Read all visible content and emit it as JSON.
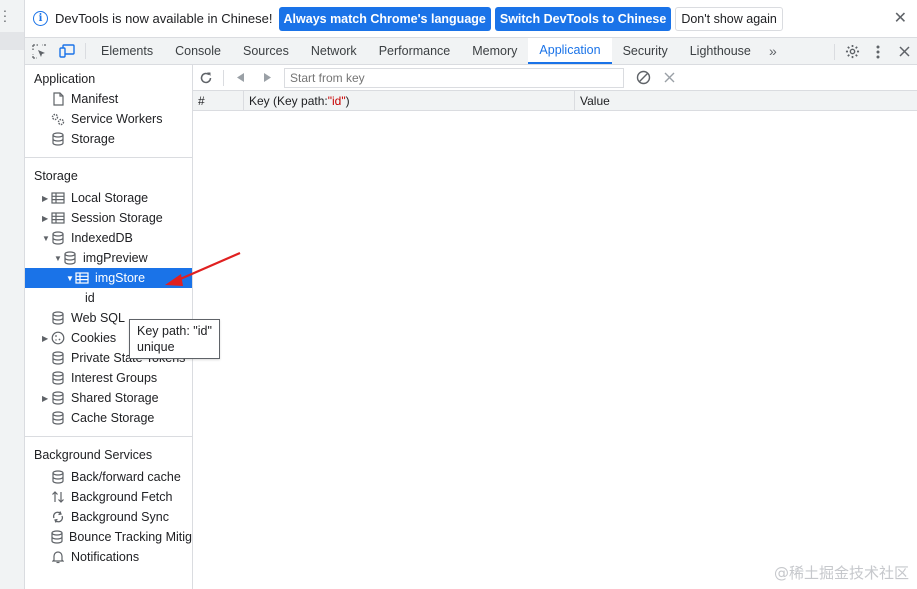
{
  "infobar": {
    "message": "DevTools is now available in Chinese!",
    "match_language_label": "Always match Chrome's language",
    "switch_label": "Switch DevTools to Chinese",
    "dismiss_label": "Don't show again",
    "close_glyph": "✕"
  },
  "tabs": [
    {
      "label": "Elements"
    },
    {
      "label": "Console"
    },
    {
      "label": "Sources"
    },
    {
      "label": "Network"
    },
    {
      "label": "Performance"
    },
    {
      "label": "Memory"
    },
    {
      "label": "Application"
    },
    {
      "label": "Security"
    },
    {
      "label": "Lighthouse"
    }
  ],
  "more_tabs_glyph": "»",
  "sidebar": {
    "application": {
      "title": "Application",
      "items": [
        {
          "label": "Manifest"
        },
        {
          "label": "Service Workers"
        },
        {
          "label": "Storage"
        }
      ]
    },
    "storage": {
      "title": "Storage",
      "items": [
        {
          "label": "Local Storage"
        },
        {
          "label": "Session Storage"
        },
        {
          "label": "IndexedDB"
        },
        {
          "label": "imgPreview"
        },
        {
          "label": "imgStore"
        },
        {
          "label": "id"
        },
        {
          "label": "Web SQL"
        },
        {
          "label": "Cookies"
        },
        {
          "label": "Private State Tokens"
        },
        {
          "label": "Interest Groups"
        },
        {
          "label": "Shared Storage"
        },
        {
          "label": "Cache Storage"
        }
      ]
    },
    "background": {
      "title": "Background Services",
      "items": [
        {
          "label": "Back/forward cache"
        },
        {
          "label": "Background Fetch"
        },
        {
          "label": "Background Sync"
        },
        {
          "label": "Bounce Tracking Mitig"
        },
        {
          "label": "Notifications"
        }
      ]
    }
  },
  "main": {
    "key_placeholder": "Start from key",
    "columns": {
      "index": "#",
      "key_prefix": "Key (Key path: ",
      "key_path": "\"id\"",
      "key_suffix": ")",
      "value": "Value"
    }
  },
  "tooltip": {
    "line1": "Key path: \"id\"",
    "line2": "unique"
  },
  "watermark": "@稀土掘金技术社区",
  "colors": {
    "accent": "#1a73e8",
    "annotation": "#e02020"
  }
}
